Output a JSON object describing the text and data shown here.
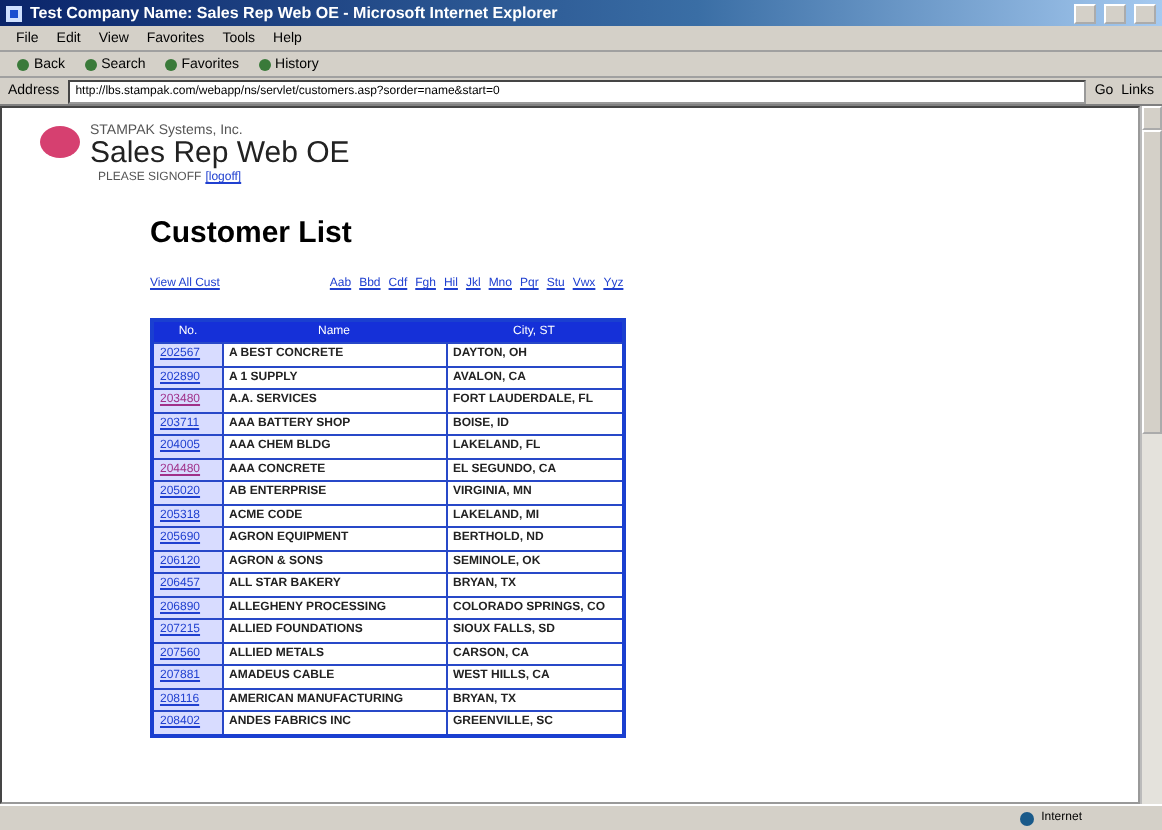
{
  "window": {
    "title": "Test Company Name: Sales Rep Web OE - Microsoft Internet Explorer"
  },
  "menu": [
    "File",
    "Edit",
    "View",
    "Favorites",
    "Tools",
    "Help"
  ],
  "toolbar": [
    "Back",
    "Search",
    "Favorites",
    "History"
  ],
  "address": {
    "label": "Address",
    "value": "http://lbs.stampak.com/webapp/ns/servlet/customers.asp?sorder=name&start=0",
    "go": "Go",
    "links": "Links"
  },
  "header": {
    "company": "STAMPAK Systems, Inc.",
    "app": "Sales Rep Web OE",
    "user": "PLEASE SIGNOFF",
    "logoff": "[logoff]"
  },
  "page_title": "Customer List",
  "view_all": "View All Cust",
  "index_links": [
    "Aab",
    "Bbd",
    "Cdf",
    "Fgh",
    "Hil",
    "Jkl",
    "Mno",
    "Pqr",
    "Stu",
    "Vwx",
    "Yyz"
  ],
  "table": {
    "columns": [
      "No.",
      "Name",
      "City, ST"
    ],
    "rows": [
      {
        "no": "202567",
        "name": "A BEST CONCRETE",
        "city": "DAYTON, OH",
        "visited": false
      },
      {
        "no": "202890",
        "name": "A 1 SUPPLY",
        "city": "AVALON, CA",
        "visited": false
      },
      {
        "no": "203480",
        "name": "A.A. SERVICES",
        "city": "FORT LAUDERDALE, FL",
        "visited": true
      },
      {
        "no": "203711",
        "name": "AAA BATTERY SHOP",
        "city": "BOISE, ID",
        "visited": false
      },
      {
        "no": "204005",
        "name": "AAA CHEM BLDG",
        "city": "LAKELAND, FL",
        "visited": false
      },
      {
        "no": "204480",
        "name": "AAA CONCRETE",
        "city": "EL SEGUNDO, CA",
        "visited": true
      },
      {
        "no": "205020",
        "name": "AB ENTERPRISE",
        "city": "VIRGINIA, MN",
        "visited": false
      },
      {
        "no": "205318",
        "name": "ACME CODE",
        "city": "LAKELAND, MI",
        "visited": false
      },
      {
        "no": "205690",
        "name": "AGRON EQUIPMENT",
        "city": "BERTHOLD, ND",
        "visited": false
      },
      {
        "no": "206120",
        "name": "AGRON & SONS",
        "city": "SEMINOLE, OK",
        "visited": false
      },
      {
        "no": "206457",
        "name": "ALL STAR BAKERY",
        "city": "BRYAN, TX",
        "visited": false
      },
      {
        "no": "206890",
        "name": "ALLEGHENY PROCESSING",
        "city": "COLORADO SPRINGS, CO",
        "visited": false
      },
      {
        "no": "207215",
        "name": "ALLIED FOUNDATIONS",
        "city": "SIOUX FALLS, SD",
        "visited": false
      },
      {
        "no": "207560",
        "name": "ALLIED METALS",
        "city": "CARSON, CA",
        "visited": false
      },
      {
        "no": "207881",
        "name": "AMADEUS CABLE",
        "city": "WEST HILLS, CA",
        "visited": false
      },
      {
        "no": "208116",
        "name": "AMERICAN MANUFACTURING",
        "city": "BRYAN, TX",
        "visited": false
      },
      {
        "no": "208402",
        "name": "ANDES FABRICS INC",
        "city": "GREENVILLE, SC",
        "visited": false
      }
    ]
  },
  "status": {
    "zone": "Internet"
  }
}
